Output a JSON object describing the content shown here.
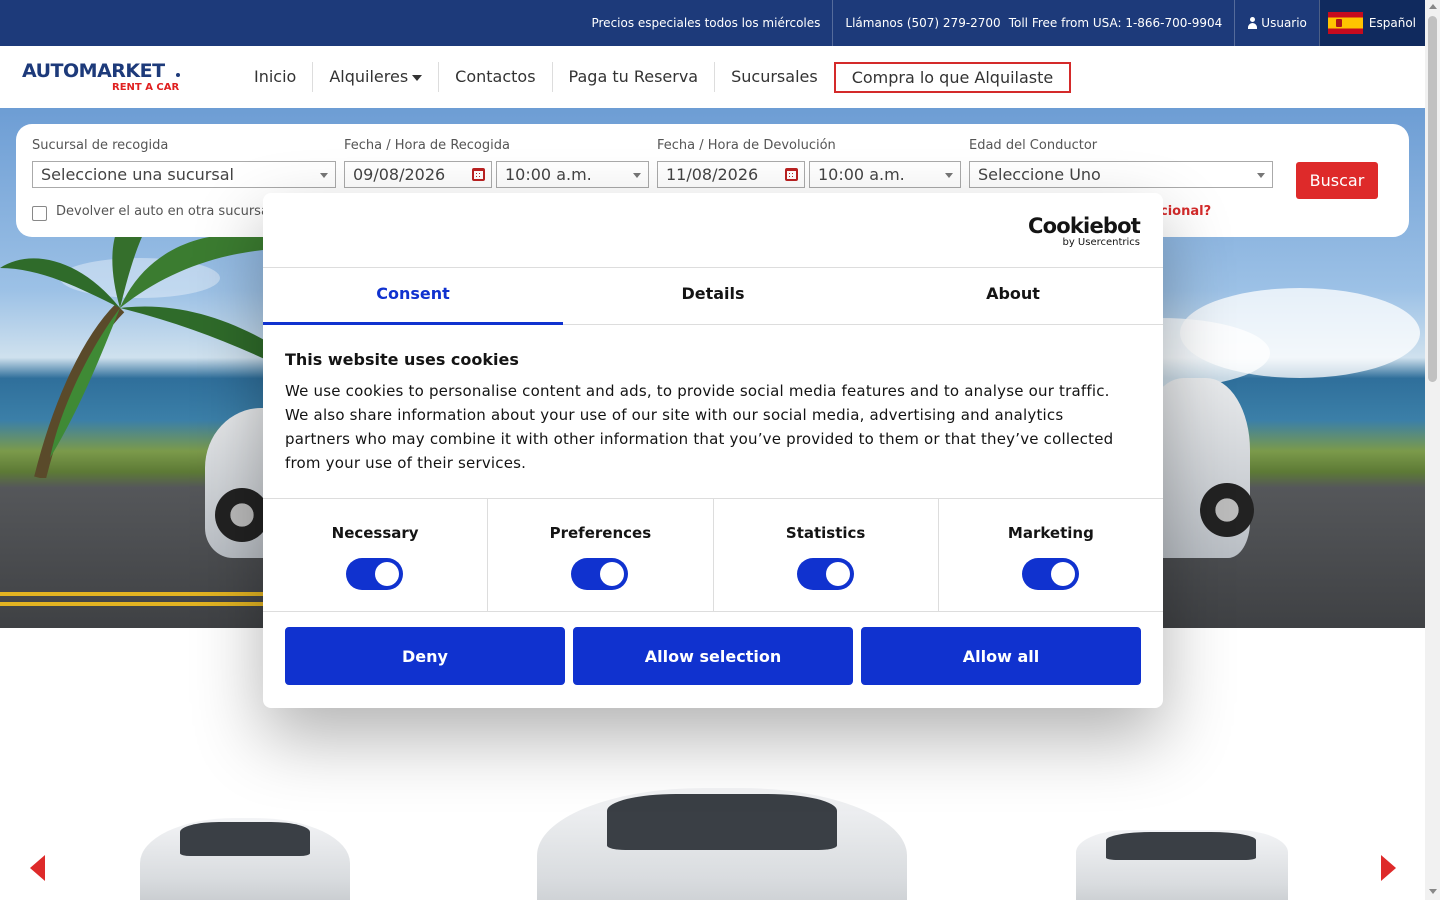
{
  "topbar": {
    "promo": "Precios especiales todos los miércoles",
    "phone": "Llámanos (507) 279-2700",
    "toll_free": "Toll Free from USA: 1-866-700-9904",
    "user": "Usuario",
    "language": "Español"
  },
  "logo": {
    "brand": "AUTOMARKET",
    "tagline": "RENT A CAR"
  },
  "nav": {
    "items": [
      "Inicio",
      "Alquileres",
      "Contactos",
      "Paga tu Reserva",
      "Sucursales",
      "Compra lo que Alquilaste"
    ]
  },
  "search": {
    "pickup_label": "Sucursal de recogida",
    "pickup_placeholder": "Seleccione una sucursal",
    "pickup_date_label": "Fecha / Hora de Recogida",
    "pickup_date": "09/08/2026",
    "pickup_time": "10:00 a.m.",
    "return_date_label": "Fecha / Hora de Devolución",
    "return_date": "11/08/2026",
    "return_time": "10:00 a.m.",
    "driver_age_label": "Edad del Conductor",
    "driver_age_placeholder": "Seleccione Uno",
    "search_button": "Buscar",
    "return_other": "Devolver el auto en otra sucursal",
    "partial_link": "cional?"
  },
  "cookie": {
    "brand": "Cookiebot",
    "brand_sub": "by Usercentrics",
    "tabs": [
      "Consent",
      "Details",
      "About"
    ],
    "title": "This website uses cookies",
    "body": "We use cookies to personalise content and ads, to provide social media features and to analyse our traffic. We also share information about your use of our site with our social media, advertising and analytics partners who may combine it with other information that you’ve provided to them or that they’ve collected from your use of their services.",
    "toggles": [
      "Necessary",
      "Preferences",
      "Statistics",
      "Marketing"
    ],
    "buttons": {
      "deny": "Deny",
      "allow_selection": "Allow selection",
      "allow_all": "Allow all"
    }
  },
  "colors": {
    "topbar": "#1d3a7a",
    "accent_red": "#de2a2a",
    "cookie_blue": "#1032cf"
  }
}
